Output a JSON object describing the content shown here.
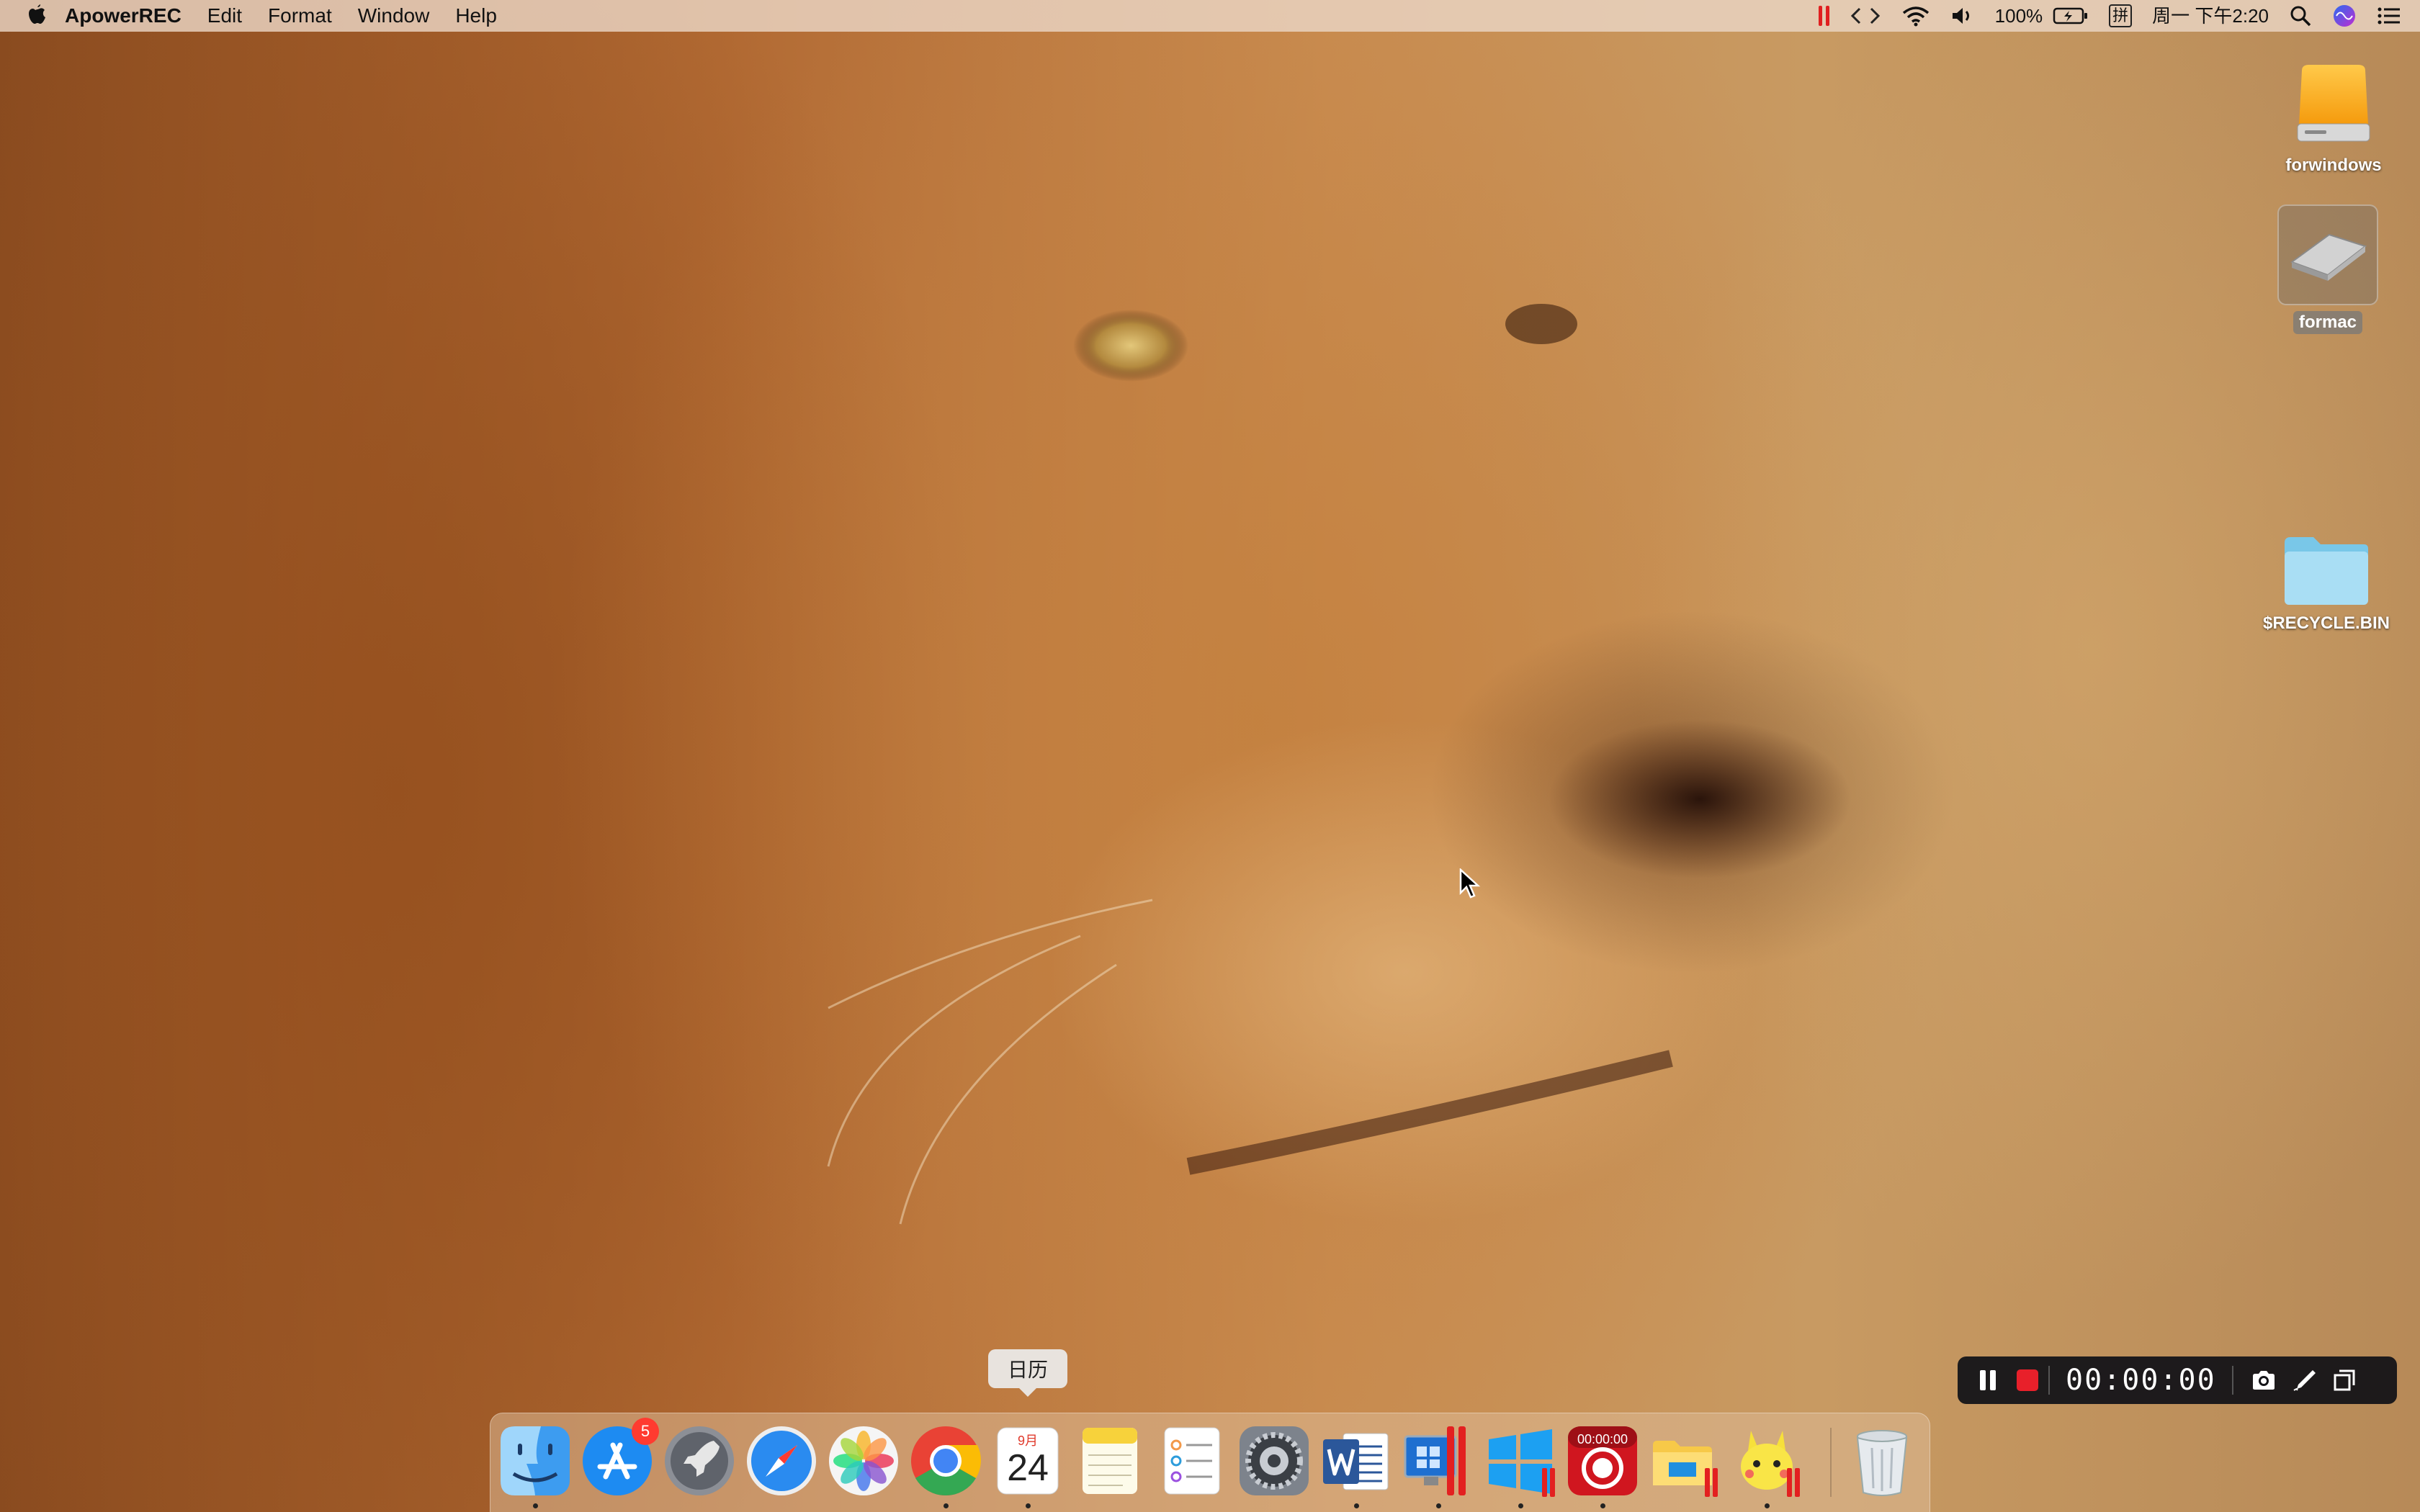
{
  "menubar": {
    "app_name": "ApowerREC",
    "menus": [
      "Edit",
      "Format",
      "Window",
      "Help"
    ],
    "battery": "100%",
    "input_method": "拼",
    "clock": "周一 下午2:20"
  },
  "desktop": {
    "icons": [
      {
        "label": "forwindows",
        "type": "external-drive-icon"
      },
      {
        "label": "formac",
        "type": "removable-drive-icon",
        "selected": true
      },
      {
        "label": "$RECYCLE.BIN",
        "type": "folder-icon"
      }
    ]
  },
  "dock": {
    "tooltip": "日历",
    "appstore_badge": "5",
    "calendar_month": "9月",
    "calendar_day": "24",
    "recorder_timer": "00:00:00",
    "items": [
      "finder-icon",
      "app-store-icon",
      "launchpad-icon",
      "safari-icon",
      "photos-icon",
      "chrome-icon",
      "calendar-icon",
      "notes-icon",
      "reminders-icon",
      "system-preferences-icon",
      "word-icon",
      "parallels-icon",
      "windows-icon",
      "apowerrec-icon",
      "file-explorer-icon",
      "pikachu-icon",
      "trash-icon"
    ]
  },
  "recorder_bar": {
    "timer": "00:00:00",
    "recording_color": "#e8202a"
  }
}
